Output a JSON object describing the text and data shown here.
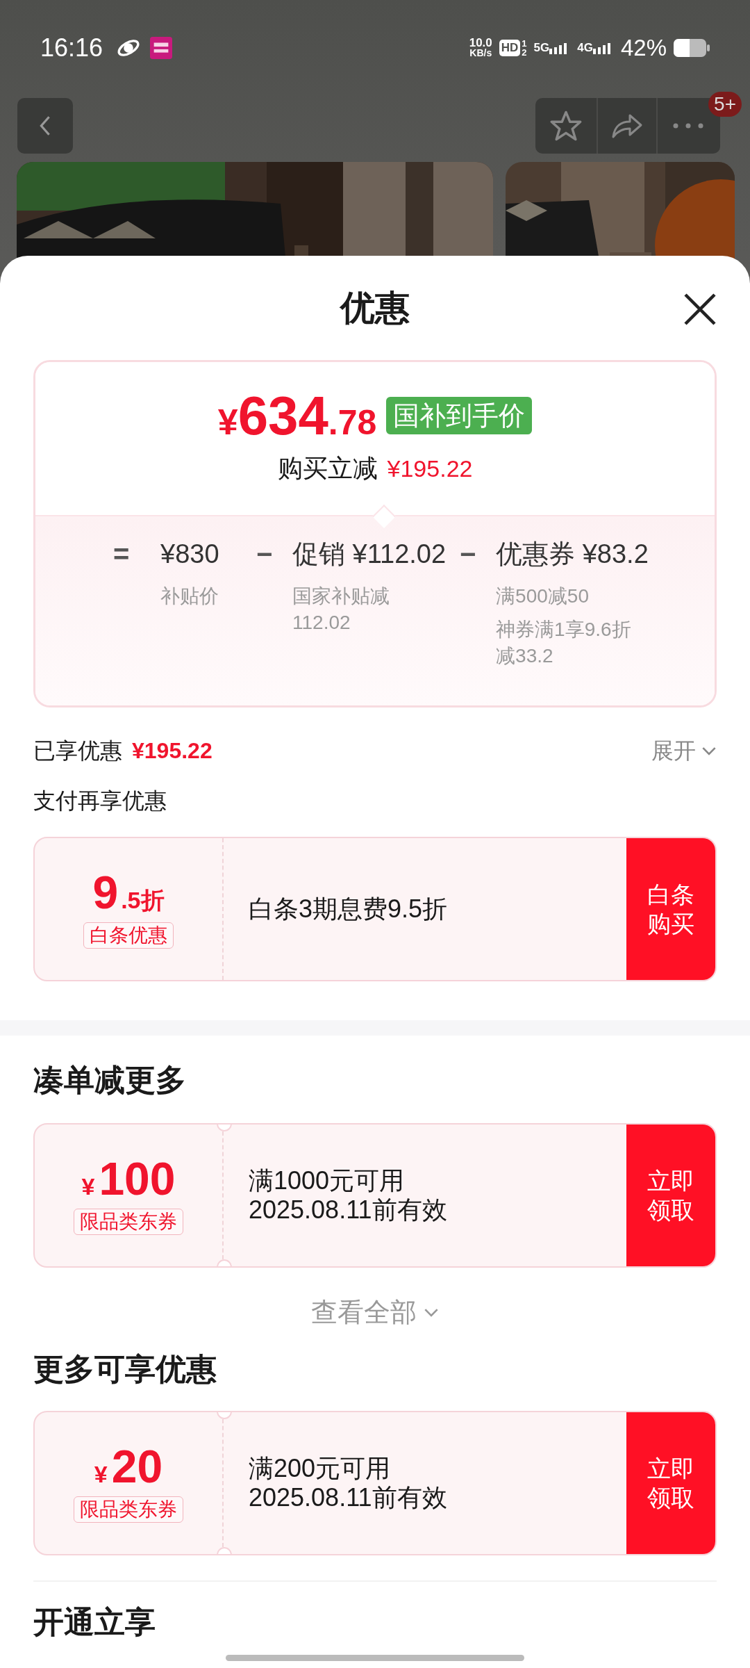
{
  "status_bar": {
    "time": "16:16",
    "net_speed": [
      "10.0",
      "KB/s"
    ],
    "hd": "HD",
    "hd_slots": [
      "1",
      "2"
    ],
    "networks": [
      "5G",
      "4G"
    ],
    "battery": "42%"
  },
  "nav": {
    "badge": "5+"
  },
  "sheet": {
    "title": "优惠"
  },
  "price_card": {
    "currency": "¥",
    "price_int": "634",
    "price_dec": ".78",
    "tag": "国补到手价",
    "reduction_label": "购买立减",
    "reduction_value": "¥195.22",
    "terms": [
      {
        "op": "=",
        "amount": "¥830",
        "notes": [
          "补贴价"
        ]
      },
      {
        "op": "−",
        "label": "促销",
        "amount": "¥112.02",
        "notes": [
          "国家补贴减112.02"
        ]
      },
      {
        "op": "−",
        "label": "优惠券",
        "amount": "¥83.2",
        "notes": [
          "满500减50",
          "神券满1享9.6折减33.2"
        ]
      }
    ]
  },
  "savings": {
    "label": "已享优惠",
    "value": "¥195.22",
    "expand": "展开"
  },
  "sections": [
    {
      "title": "支付再享优惠",
      "cards": [
        {
          "kind": "discount",
          "big": "9",
          "small": ".5折",
          "tag": "白条优惠",
          "lines": [
            "白条3期息费9.5折"
          ],
          "button": "白条购买"
        }
      ]
    },
    {
      "title": "凑单减更多",
      "cards": [
        {
          "kind": "coupon",
          "currency": "¥",
          "amount": "100",
          "tag": "限品类东券",
          "lines": [
            "满1000元可用",
            "2025.08.11前有效"
          ],
          "button": "立即领取"
        }
      ],
      "more": "查看全部"
    },
    {
      "title": "更多可享优惠",
      "cards": [
        {
          "kind": "coupon",
          "currency": "¥",
          "amount": "20",
          "tag": "限品类东券",
          "lines": [
            "满200元可用",
            "2025.08.11前有效"
          ],
          "button": "立即领取"
        }
      ]
    },
    {
      "title": "开通立享"
    }
  ]
}
